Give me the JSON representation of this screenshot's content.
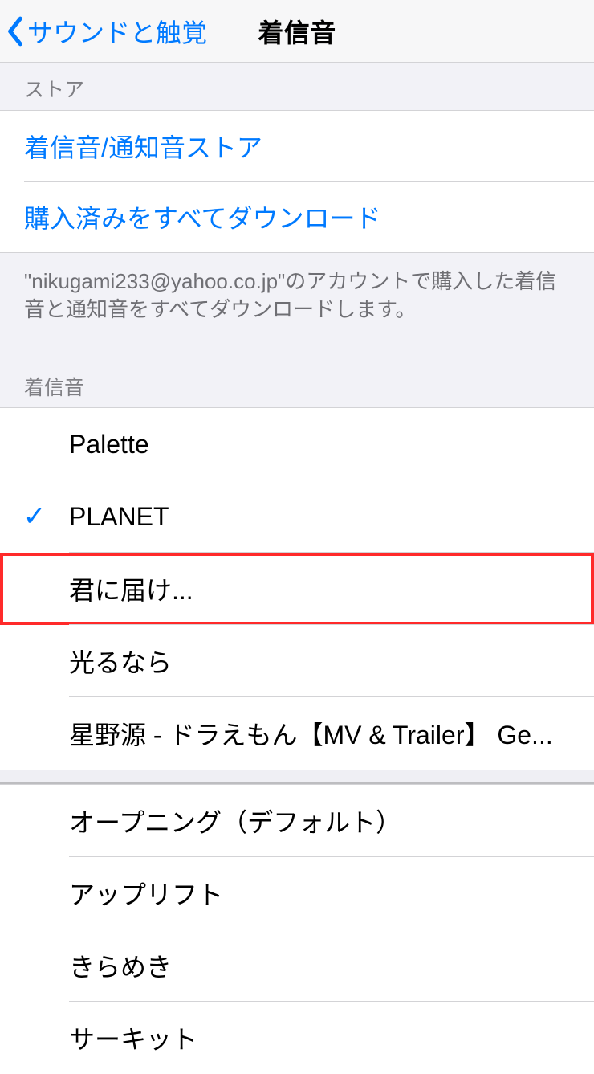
{
  "nav": {
    "back_label": "サウンドと触覚",
    "title": "着信音"
  },
  "store_section": {
    "header": "ストア",
    "items": [
      {
        "label": "着信音/通知音ストア"
      },
      {
        "label": "購入済みをすべてダウンロード"
      }
    ],
    "footer": "\"nikugami233@yahoo.co.jp\"のアカウントで購入した着信音と通知音をすべてダウンロードします。"
  },
  "ringtone_section": {
    "header": "着信音",
    "custom": [
      {
        "label": "Palette",
        "selected": false,
        "highlight": false
      },
      {
        "label": "PLANET",
        "selected": true,
        "highlight": false
      },
      {
        "label": "君に届け...",
        "selected": false,
        "highlight": true
      },
      {
        "label": "光るなら",
        "selected": false,
        "highlight": false
      },
      {
        "label": "星野源 - ドラえもん【MV & Trailer】 Ge...",
        "selected": false,
        "highlight": false
      }
    ],
    "builtin": [
      {
        "label": "オープニング（デフォルト）"
      },
      {
        "label": "アップリフト"
      },
      {
        "label": "きらめき"
      },
      {
        "label": "サーキット"
      }
    ]
  }
}
